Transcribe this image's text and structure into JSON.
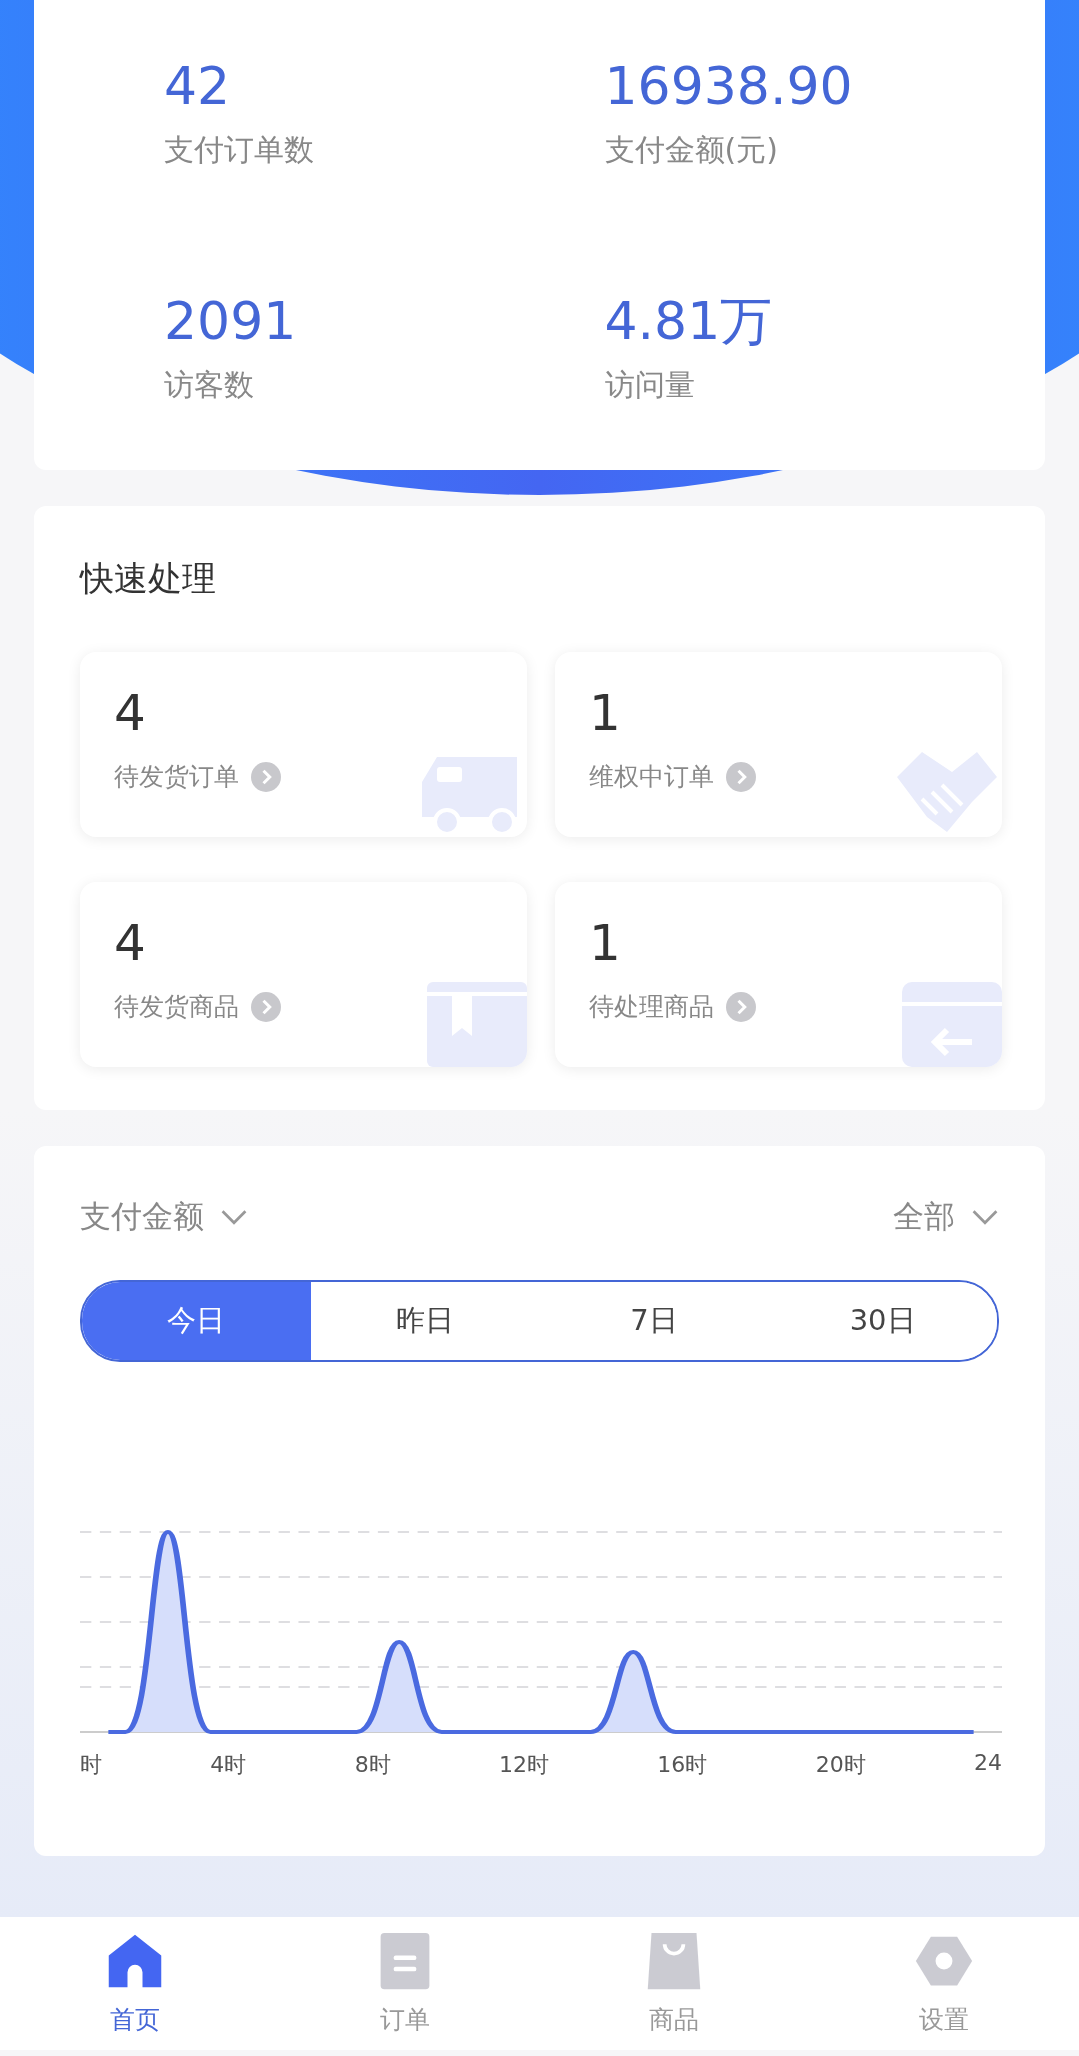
{
  "stats": [
    {
      "value": "42",
      "label": "支付订单数"
    },
    {
      "value": "16938.90",
      "label": "支付金额(元)"
    },
    {
      "value": "2091",
      "label": "访客数"
    },
    {
      "value": "4.81万",
      "label": "访问量"
    }
  ],
  "quick": {
    "title": "快速处理",
    "items": [
      {
        "count": "4",
        "label": "待发货订单",
        "kind": "truck"
      },
      {
        "count": "1",
        "label": "维权中订单",
        "kind": "handshake"
      },
      {
        "count": "4",
        "label": "待发货商品",
        "kind": "box"
      },
      {
        "count": "1",
        "label": "待处理商品",
        "kind": "return"
      }
    ]
  },
  "chart_panel": {
    "metric": "支付金额",
    "filter": "全部",
    "tabs": [
      {
        "label": "今日",
        "selected": true
      },
      {
        "label": "昨日",
        "selected": false
      },
      {
        "label": "7日",
        "selected": false
      },
      {
        "label": "30日",
        "selected": false
      }
    ],
    "x_labels": [
      "时",
      "4时",
      "8时",
      "12时",
      "16时",
      "20时",
      "24"
    ]
  },
  "nav": [
    {
      "label": "首页",
      "kind": "home",
      "selected": true
    },
    {
      "label": "订单",
      "kind": "orders",
      "selected": false
    },
    {
      "label": "商品",
      "kind": "bag",
      "selected": false
    },
    {
      "label": "设置",
      "kind": "gear",
      "selected": false
    }
  ]
}
